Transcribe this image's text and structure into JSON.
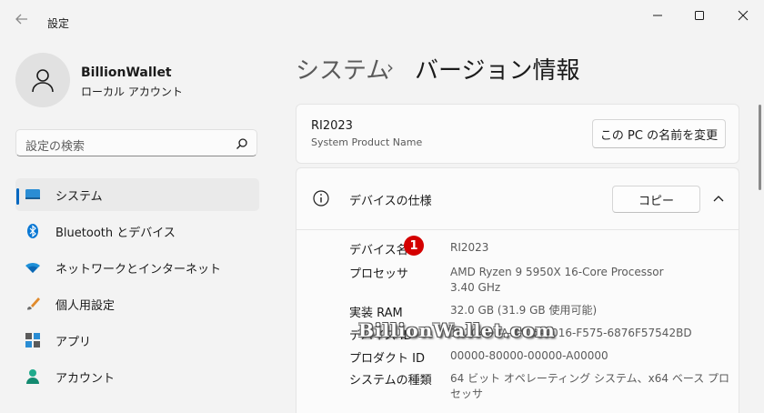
{
  "window": {
    "title": "設定"
  },
  "user": {
    "name": "BillionWallet",
    "account_type": "ローカル アカウント"
  },
  "search": {
    "placeholder": "設定の検索"
  },
  "nav": {
    "items": [
      {
        "label": "システム",
        "icon": "monitor-icon",
        "selected": true
      },
      {
        "label": "Bluetooth とデバイス",
        "icon": "bluetooth-icon",
        "selected": false
      },
      {
        "label": "ネットワークとインターネット",
        "icon": "wifi-icon",
        "selected": false
      },
      {
        "label": "個人用設定",
        "icon": "paintbrush-icon",
        "selected": false
      },
      {
        "label": "アプリ",
        "icon": "apps-icon",
        "selected": false
      },
      {
        "label": "アカウント",
        "icon": "person-icon",
        "selected": false
      }
    ]
  },
  "header": {
    "crumb1": "システム",
    "separator": "›",
    "crumb2": "バージョン情報"
  },
  "product": {
    "name": "RI2023",
    "subtitle": "System Product Name",
    "rename_label": "この PC の名前を変更"
  },
  "specs": {
    "title": "デバイスの仕様",
    "copy_label": "コピー",
    "badge": "1",
    "rows": [
      {
        "key": "デバイス名",
        "value": "RI2023"
      },
      {
        "key": "プロセッサ",
        "value": "AMD Ryzen 9 5950X 16-Core Processor",
        "value2": "3.40 GHz"
      },
      {
        "key": "実装 RAM",
        "value": "32.0 GB (31.9 GB 使用可能)"
      },
      {
        "key": "デバイス ID",
        "value": "1E2C4D9A-4A75-4016-F575-6876F57542BD"
      },
      {
        "key": "プロダクト ID",
        "value": "00000-80000-00000-A00000"
      },
      {
        "key": "システムの種類",
        "value": "64 ビット オペレーティング システム、x64 ベース プロ",
        "value2": "セッサ"
      }
    ]
  },
  "watermark": "BillionWallet.com",
  "colors": {
    "accent": "#0067c0",
    "badge": "#d40000"
  }
}
